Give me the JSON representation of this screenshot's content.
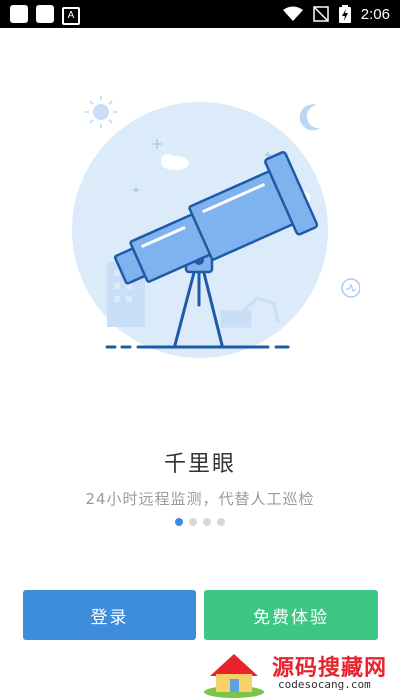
{
  "status_bar": {
    "time": "2:06",
    "icons": [
      "app-square-icon",
      "app-square-icon",
      "text-a-icon",
      "wifi-icon",
      "no-signal-icon",
      "battery-charging-icon"
    ]
  },
  "hero": {
    "illustration": "telescope-illustration"
  },
  "app": {
    "title": "千里眼",
    "subtitle": "24小时远程监测，代替人工巡检"
  },
  "pager": {
    "total": 4,
    "active": 1
  },
  "buttons": {
    "login_label": "登录",
    "trial_label": "免费体验"
  },
  "colors": {
    "primary": "#3d8ddb",
    "success": "#3ec684",
    "hero_bg": "#dcebfa",
    "telescope_fill": "#7fb3ef",
    "telescope_stroke": "#1f5aa8"
  },
  "watermark": {
    "text": "源码搜藏网",
    "url": "codesocang.com"
  }
}
